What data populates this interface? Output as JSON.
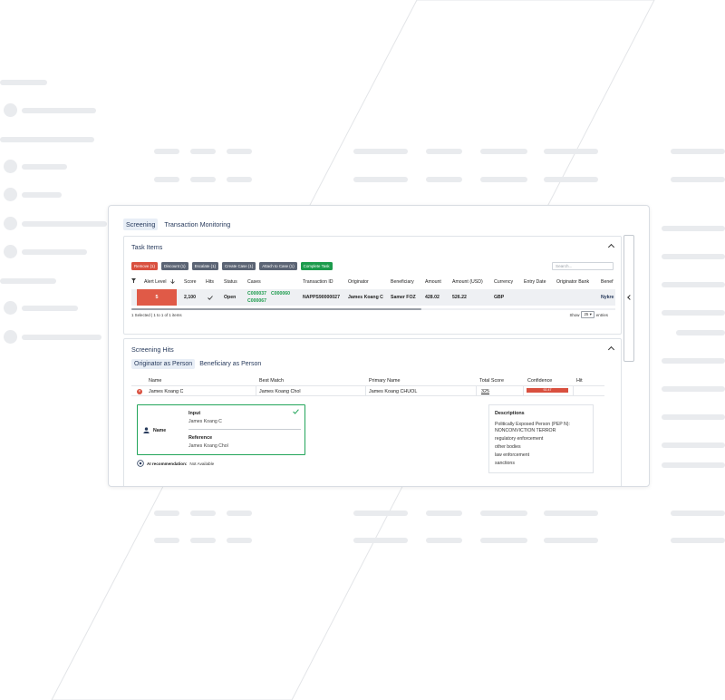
{
  "main_tabs": [
    {
      "label": "Screening",
      "active": true
    },
    {
      "label": "Transaction Monitoring",
      "active": false
    }
  ],
  "task_items": {
    "title": "Task Items",
    "actions": [
      {
        "label": "Remove (1)",
        "color": "#d9503f"
      },
      {
        "label": "Discount (1)",
        "color": "#5b6474"
      },
      {
        "label": "Escalate (1)",
        "color": "#5b6474"
      },
      {
        "label": "Create Case (1)",
        "color": "#5b6474"
      },
      {
        "label": "Attach to Case (1)",
        "color": "#5b6474"
      },
      {
        "label": "Complete Task",
        "color": "#1c9b4c"
      }
    ],
    "search_placeholder": "Search...",
    "columns": [
      "Alert Level",
      "Score",
      "Hits",
      "Status",
      "Cases",
      "Transaction ID",
      "Originator",
      "Beneficiary",
      "Amount",
      "Amount (USD)",
      "Currency",
      "Entry Date",
      "Originator Bank",
      "Benef"
    ],
    "row": {
      "alert_level": "5",
      "score": "2,100",
      "status": "Open",
      "cases": [
        "C000037",
        "C000060",
        "C000067"
      ],
      "transaction_id": "NAPPS90000027",
      "originator": "James Koang C",
      "beneficiary": "Samer FOZ",
      "amount": "428.02",
      "amount_usd": "526.22",
      "currency": "GBP",
      "benef_bank": "Nykre"
    },
    "footer": "1 Selected | 1 to 1 of 1 items",
    "show_label": "Show",
    "page_size": "25",
    "entries_label": "entries"
  },
  "screening_hits": {
    "title": "Screening Hits",
    "subtabs": [
      {
        "label": "Originator as Person",
        "active": true
      },
      {
        "label": "Beneficiary as Person",
        "active": false
      }
    ],
    "columns": [
      "Name",
      "Best Match",
      "Primary Name",
      "Total Score",
      "Confidence",
      "Hit"
    ],
    "row": {
      "name": "James Koang C",
      "best_match": "James Koang Chol",
      "primary_name": "James Koang CHUOL",
      "total_score": "325",
      "confidence": "92.47",
      "confidence_fill": 0.92
    },
    "detail": {
      "field_label": "Name",
      "input_title": "Input",
      "input_value": "James Koang C",
      "reference_title": "Reference",
      "reference_value": "James Koang Chol"
    },
    "ai": {
      "label": "AI recommendation:",
      "value": "Not Available"
    },
    "descriptions": {
      "title": "Descriptions",
      "lines": [
        "Politically Exposed Person (PEP N):",
        "NONCONVICTION TERROR",
        "regulatory enforcement",
        "other bodies",
        "law enforcement",
        "sanctions"
      ]
    }
  },
  "colors": {
    "accent": "#273a5c",
    "danger": "#d9503f",
    "success": "#1c9b4c"
  }
}
